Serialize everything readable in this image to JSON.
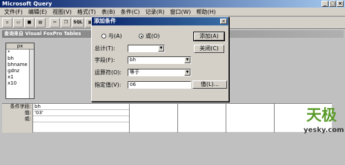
{
  "app": {
    "title": "Microsoft Query"
  },
  "menu": [
    "文件(F)",
    "编辑(E)",
    "视图(V)",
    "格式(T)",
    "表(B)",
    "条件(C)",
    "记录(R)",
    "窗口(W)",
    "帮助(H)"
  ],
  "toolbar": {
    "sql_label": "SQL",
    "icons": [
      "new-query-icon",
      "open-icon",
      "save-icon",
      "print-icon",
      "cut-icon",
      "copy-icon",
      "paste-icon",
      "sql-icon",
      "show-tables-icon",
      "show-criteria-icon",
      "add-tables-icon",
      "criteria-equals-icon",
      "filter-icon",
      "sort-asc-icon",
      "sort-desc-icon",
      "query-now-icon",
      "auto-query-icon",
      "help-icon"
    ]
  },
  "query_window": {
    "title": "查询来自 Visual FoxPro Tables"
  },
  "table_box": {
    "title": "px",
    "fields": [
      "*",
      "bh",
      "bhname",
      "gdnz",
      "x1",
      "x10"
    ]
  },
  "criteria_grid": {
    "labels": [
      "条件字段:",
      "值:",
      "或:"
    ],
    "field_value": "bh",
    "value_value": "'03'"
  },
  "dialog": {
    "title": "添加条件",
    "radio_and": "与(A)",
    "radio_or": "或(O)",
    "total_label": "总计(T):",
    "total_value": "",
    "field_label": "字段(F):",
    "field_value": "bh",
    "operator_label": "运算符(O):",
    "operator_value": "等于",
    "value_label": "指定值(V):",
    "value_value": "06",
    "add_button": "添加(A)",
    "close_button": "关闭(C)",
    "values_button": "值(L)..."
  },
  "watermark": {
    "logo": "天极",
    "url": "yesky.com"
  }
}
